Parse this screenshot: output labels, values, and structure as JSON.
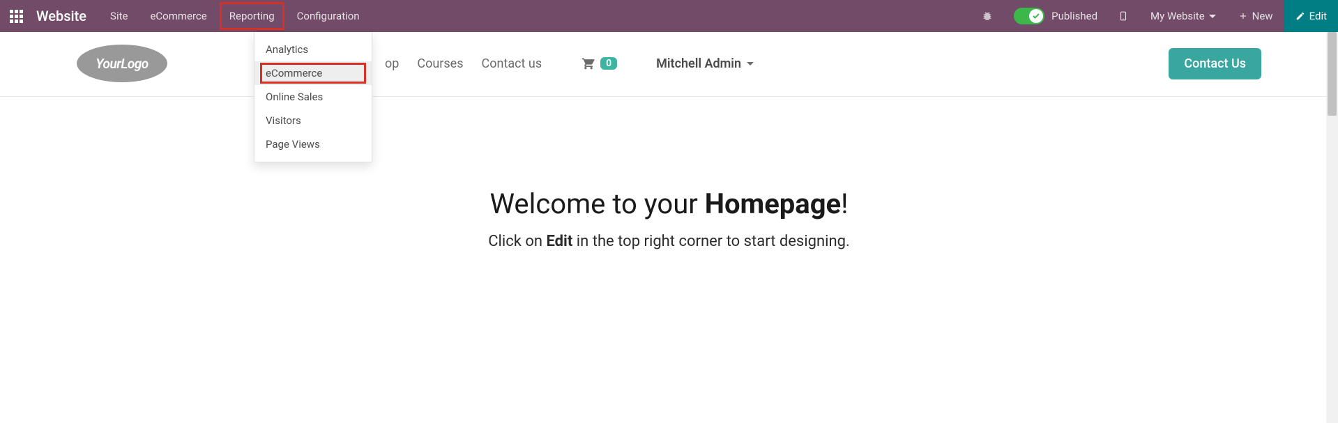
{
  "topbar": {
    "brand": "Website",
    "menu": [
      {
        "label": "Site"
      },
      {
        "label": "eCommerce"
      },
      {
        "label": "Reporting",
        "highlighted": true
      },
      {
        "label": "Configuration"
      }
    ],
    "published_label": "Published",
    "my_website_label": "My Website",
    "new_label": "New",
    "edit_label": "Edit"
  },
  "dropdown": {
    "items": [
      {
        "label": "Analytics"
      },
      {
        "label": "eCommerce",
        "highlighted": true,
        "hovered": true
      },
      {
        "label": "Online Sales"
      },
      {
        "label": "Visitors"
      },
      {
        "label": "Page Views"
      }
    ]
  },
  "siteheader": {
    "logo_text_prefix": "Your",
    "logo_text_suffix": "Logo",
    "nav": {
      "shop": "op",
      "courses": "Courses",
      "contact_us": "Contact us"
    },
    "cart_count": "0",
    "user_name": "Mitchell Admin",
    "contact_button": "Contact Us"
  },
  "page": {
    "welcome_prefix": "Welcome to your ",
    "welcome_bold": "Homepage",
    "welcome_suffix": "!",
    "sub_prefix": "Click on ",
    "sub_bold": "Edit",
    "sub_suffix": " in the top right corner to start designing."
  }
}
